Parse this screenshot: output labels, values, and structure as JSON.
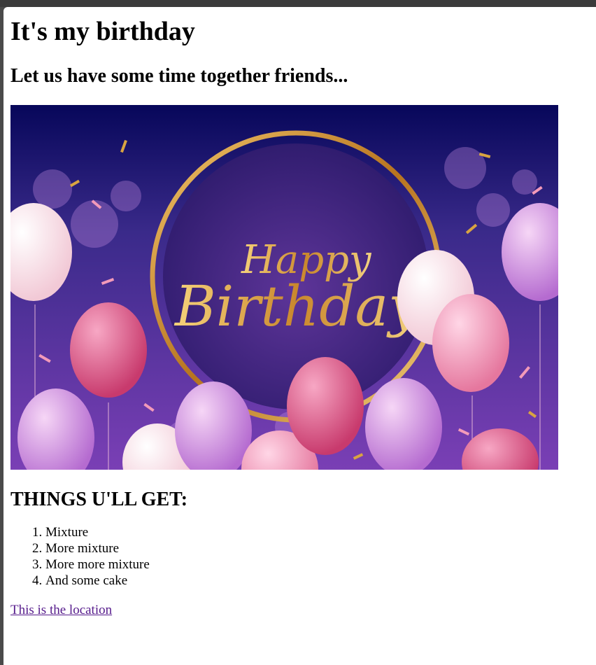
{
  "page": {
    "title": "It's my birthday",
    "subtitle": "Let us have some time together friends...",
    "image": {
      "alt": "Happy Birthday",
      "greeting_line1": "Happy",
      "greeting_line2": "Birthday"
    },
    "list_heading": "THINGS U'LL GET:",
    "items": [
      "Mixture",
      "More mixture",
      "More more mixture",
      "And some cake"
    ],
    "link_text": "This is the location"
  },
  "colors": {
    "link": "#551a8b",
    "banner_top": "#0b0b58",
    "banner_mid": "#4b2a8f",
    "gold": "#d9a441"
  }
}
